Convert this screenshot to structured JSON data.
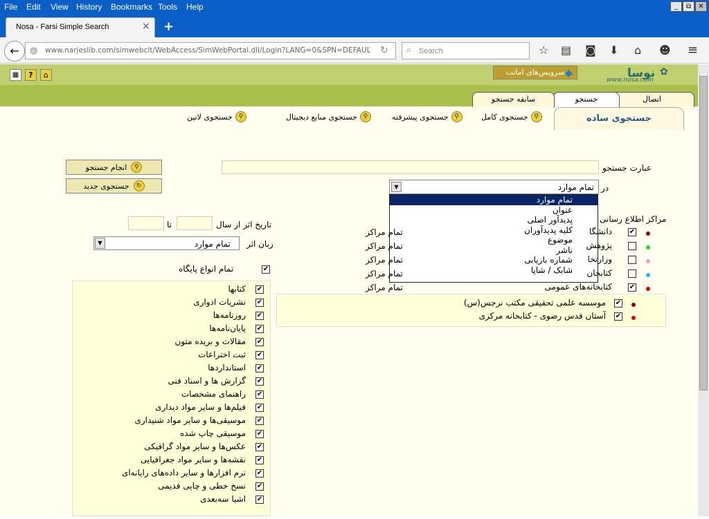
{
  "menubar": {
    "items": [
      "File",
      "Edit",
      "View",
      "History",
      "Bookmarks",
      "Tools",
      "Help"
    ],
    "window_buttons": [
      "_",
      "⧉",
      "✕"
    ]
  },
  "tab": {
    "title": "Nosa - Farsi Simple Search",
    "close": "×",
    "new": "+"
  },
  "nav": {
    "url": "www.narjeslib.com/simwebclt/WebAccess/SimWebPortal.dll/Login?LANG=0&SPN=DEFAULT&I",
    "search_placeholder": "Search"
  },
  "header": {
    "service_label": "سرویس‌های امانت",
    "brand": "نوسا",
    "brand_url": "www.nosa.com"
  },
  "toptabs": [
    "اتصال",
    "جستجو",
    "سابقه جستجو"
  ],
  "subtabs": {
    "simple": "جستجوی ساده",
    "items": [
      "جستجوی کامل",
      "جستجوی پیشرفته",
      "جستجوی منابع دیجیتال",
      "جستجوی لاتین"
    ]
  },
  "form": {
    "query_label": "عبارت جستجو",
    "in_label": "در",
    "in_value": "تمام موارد",
    "search_btn": "انجام جستجو",
    "new_btn": "جستجوی جدید",
    "date_label": "تاریخ اثر از سال",
    "to_label": "تا",
    "lang_label": "زبان اثر",
    "lang_value": "تمام موارد",
    "all_types": "تمام انواع پایگاه",
    "centers_label": "مراکز اطلاع رسانی",
    "all_centers": "تمام مراکز",
    "public_libs": "کتابخانه‌های عمومی"
  },
  "dropdown_options": [
    "تمام موارد",
    "عنوان",
    "پدیدآور اصلی",
    "کلیه پدیدآوران",
    "موضوع",
    "ناشر",
    "شماره بازیابی",
    "شابک / شاپا"
  ],
  "centers": [
    {
      "label": "دانشگا",
      "color": "#8b0000",
      "checked": true
    },
    {
      "label": "پژوهش",
      "color": "#33cc33",
      "checked": false
    },
    {
      "label": "وزارتخا",
      "color": "#ff99cc",
      "checked": false
    },
    {
      "label": "کتابخان",
      "color": "#33aaff",
      "checked": false
    },
    {
      "label": "کتابخانه‌های عمومی",
      "color": "#dd0000",
      "checked": true
    }
  ],
  "libraries": [
    {
      "label": "موسسه علمی تحقیقی مکتب نرجس(س)",
      "color": "#8b0000"
    },
    {
      "label": "آستان قدس رضوی - کتابخانه مرکزی",
      "color": "#dd0000"
    }
  ],
  "types": [
    "کتابها",
    "نشریات ادواری",
    "روزنامه‌ها",
    "پایان‌نامه‌ها",
    "مقالات و بریده متون",
    "ثبت اختراعات",
    "استانداردها",
    "گزارش ها و اسناد فنی",
    "راهنمای مشخصات",
    "فیلم‌ها و سایر مواد دیداری",
    "موسیقی‌ها و سایر مواد شنیداری",
    "موسیقی چاپ شده",
    "عکس‌ها و سایر مواد گرافیکی",
    "نقشه‌ها و سایر مواد جغرافیایی",
    "نرم افزارها و سایر داده‌های رایانه‌ای",
    "نسخ خطی و چاپی قدیمی",
    "اشیا سه‌بعدی"
  ]
}
